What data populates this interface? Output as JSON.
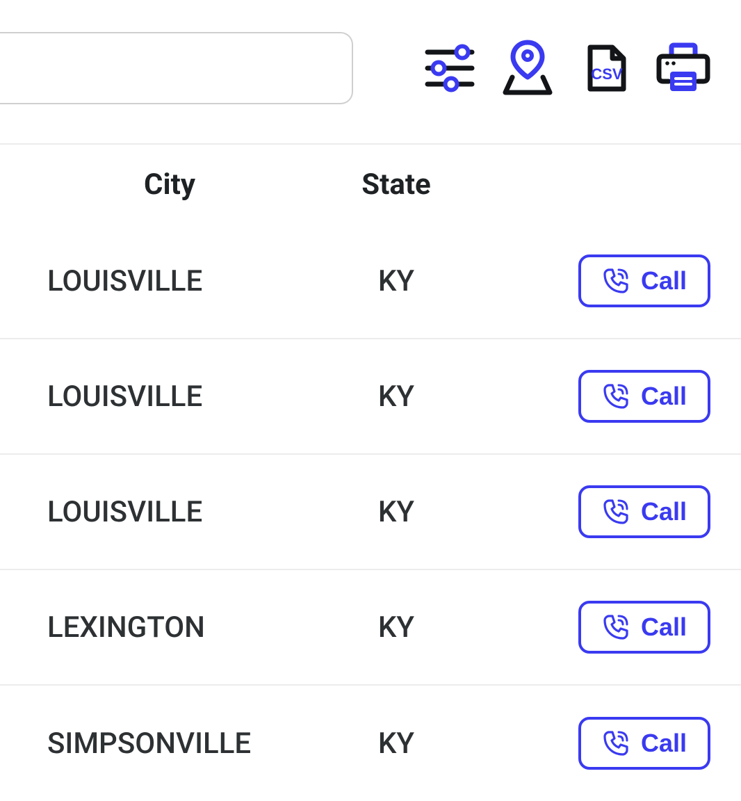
{
  "colors": {
    "accent": "#3a3af1",
    "text": "#1f2224",
    "border": "#ececee"
  },
  "search": {
    "value": "",
    "placeholder": ""
  },
  "toolbar": {
    "filter_label": "Filters",
    "map_label": "Map",
    "csv_label": "CSV",
    "print_label": "Print"
  },
  "table": {
    "headers": {
      "city": "City",
      "state": "State"
    },
    "call_label": "Call",
    "rows": [
      {
        "city": "LOUISVILLE",
        "state": "KY"
      },
      {
        "city": "LOUISVILLE",
        "state": "KY"
      },
      {
        "city": "LOUISVILLE",
        "state": "KY"
      },
      {
        "city": "LEXINGTON",
        "state": "KY"
      },
      {
        "city": "SIMPSONVILLE",
        "state": "KY"
      }
    ]
  }
}
